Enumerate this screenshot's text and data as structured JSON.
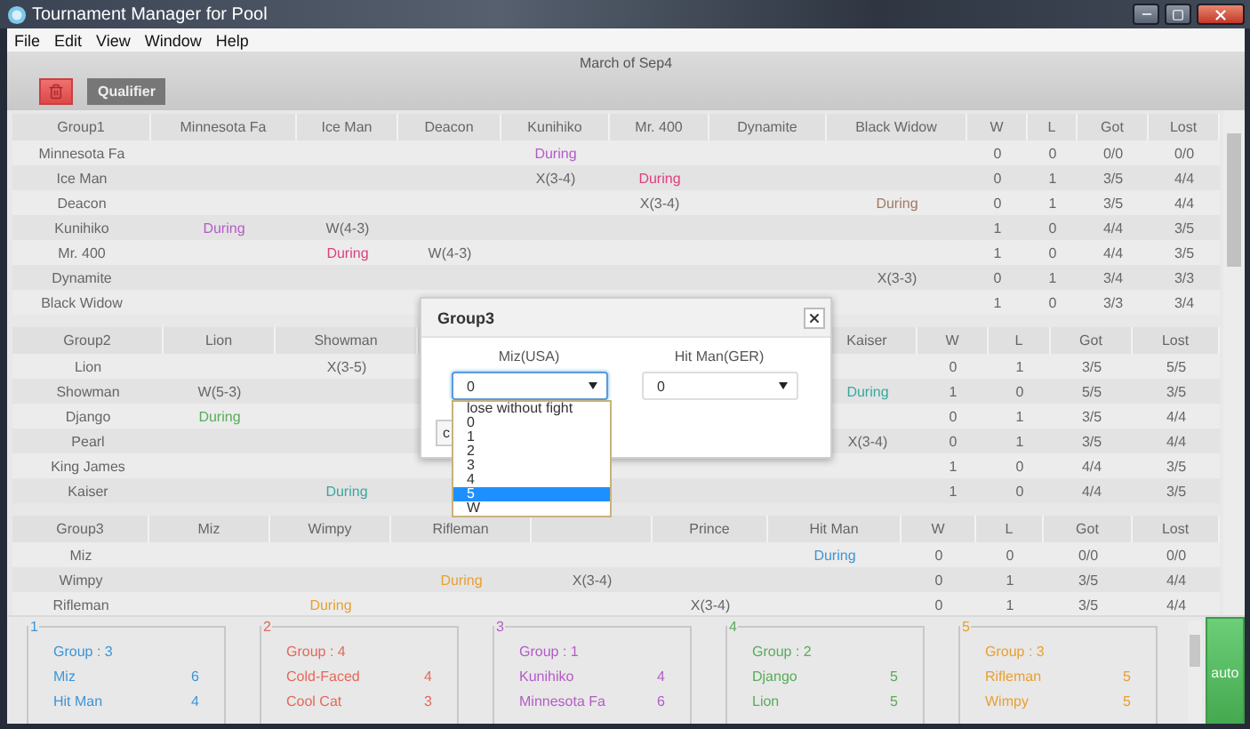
{
  "window": {
    "title": "Tournament Manager for Pool"
  },
  "menu": [
    "File",
    "Edit",
    "View",
    "Window",
    "Help"
  ],
  "header": {
    "title": "March of Sep4"
  },
  "toolbar": [
    {
      "kind": "delete"
    },
    {
      "kind": "text",
      "label": "Qualifier"
    }
  ],
  "groups": [
    {
      "columns": [
        {
          "kind": "label",
          "label": "Group1"
        },
        {
          "kind": "label",
          "label": "Minnesota Fa"
        },
        {
          "kind": "label",
          "label": "Ice Man"
        },
        {
          "kind": "label",
          "label": "Deacon"
        },
        {
          "kind": "label",
          "label": "Kunihiko"
        },
        {
          "kind": "label",
          "label": "Mr. 400"
        },
        {
          "kind": "label",
          "label": "Dynamite"
        },
        {
          "kind": "label",
          "label": "Black Widow"
        },
        {
          "kind": "label",
          "label": "W"
        },
        {
          "kind": "label",
          "label": "L"
        },
        {
          "kind": "label",
          "label": "Got"
        },
        {
          "kind": "label",
          "label": "Lost"
        }
      ],
      "rows": [
        {
          "name": "Minnesota Fa",
          "results": [
            {
              "kind": "empty"
            },
            {
              "kind": "empty"
            },
            {
              "kind": "empty"
            },
            {
              "kind": "status",
              "text": "During",
              "color": "#b25cc6"
            },
            {
              "kind": "empty"
            },
            {
              "kind": "empty"
            },
            {
              "kind": "empty"
            }
          ],
          "w": "0",
          "l": "0",
          "got": "0/0",
          "lost": "0/0"
        },
        {
          "name": "Ice Man",
          "results": [
            {
              "kind": "empty"
            },
            {
              "kind": "empty"
            },
            {
              "kind": "empty"
            },
            {
              "kind": "score",
              "text": "X(3-4)"
            },
            {
              "kind": "status",
              "text": "During",
              "color": "#dd3f7d"
            },
            {
              "kind": "empty"
            },
            {
              "kind": "empty"
            }
          ],
          "w": "0",
          "l": "1",
          "got": "3/5",
          "lost": "4/4"
        },
        {
          "name": "Deacon",
          "results": [
            {
              "kind": "empty"
            },
            {
              "kind": "empty"
            },
            {
              "kind": "empty"
            },
            {
              "kind": "empty"
            },
            {
              "kind": "score",
              "text": "X(3-4)"
            },
            {
              "kind": "empty"
            },
            {
              "kind": "status",
              "text": "During",
              "color": "#a07862"
            }
          ],
          "w": "0",
          "l": "1",
          "got": "3/5",
          "lost": "4/4"
        },
        {
          "name": "Kunihiko",
          "results": [
            {
              "kind": "status",
              "text": "During",
              "color": "#b25cc6"
            },
            {
              "kind": "score",
              "text": "W(4-3)"
            },
            {
              "kind": "empty"
            },
            {
              "kind": "empty"
            },
            {
              "kind": "empty"
            },
            {
              "kind": "empty"
            },
            {
              "kind": "empty"
            }
          ],
          "w": "1",
          "l": "0",
          "got": "4/4",
          "lost": "3/5"
        },
        {
          "name": "Mr. 400",
          "results": [
            {
              "kind": "empty"
            },
            {
              "kind": "status",
              "text": "During",
              "color": "#dd3f7d"
            },
            {
              "kind": "score",
              "text": "W(4-3)"
            },
            {
              "kind": "empty"
            },
            {
              "kind": "empty"
            },
            {
              "kind": "empty"
            },
            {
              "kind": "empty"
            }
          ],
          "w": "1",
          "l": "0",
          "got": "4/4",
          "lost": "3/5"
        },
        {
          "name": "Dynamite",
          "results": [
            {
              "kind": "empty"
            },
            {
              "kind": "empty"
            },
            {
              "kind": "empty"
            },
            {
              "kind": "empty"
            },
            {
              "kind": "empty"
            },
            {
              "kind": "empty"
            },
            {
              "kind": "score",
              "text": "X(3-3)"
            }
          ],
          "w": "0",
          "l": "1",
          "got": "3/4",
          "lost": "3/3"
        },
        {
          "name": "Black Widow",
          "results": [
            {
              "kind": "empty"
            },
            {
              "kind": "empty"
            },
            {
              "kind": "empty"
            },
            {
              "kind": "empty"
            },
            {
              "kind": "empty"
            },
            {
              "kind": "empty"
            },
            {
              "kind": "empty"
            }
          ],
          "w": "1",
          "l": "0",
          "got": "3/3",
          "lost": "3/4"
        }
      ]
    },
    {
      "columns": [
        {
          "kind": "label",
          "label": "Group2"
        },
        {
          "kind": "label",
          "label": "Lion"
        },
        {
          "kind": "label",
          "label": "Showman"
        },
        {
          "kind": "blank"
        },
        {
          "kind": "blank"
        },
        {
          "kind": "blank"
        },
        {
          "kind": "label",
          "label": "Kaiser"
        },
        {
          "kind": "label",
          "label": "W"
        },
        {
          "kind": "label",
          "label": "L"
        },
        {
          "kind": "label",
          "label": "Got"
        },
        {
          "kind": "label",
          "label": "Lost"
        }
      ],
      "rows": [
        {
          "name": "Lion",
          "results": [
            {
              "kind": "empty"
            },
            {
              "kind": "score",
              "text": "X(3-5)"
            },
            {
              "kind": "empty"
            },
            {
              "kind": "empty"
            },
            {
              "kind": "empty"
            },
            {
              "kind": "empty"
            }
          ],
          "w": "0",
          "l": "1",
          "got": "3/5",
          "lost": "5/5"
        },
        {
          "name": "Showman",
          "results": [
            {
              "kind": "score",
              "text": "W(5-3)"
            },
            {
              "kind": "empty"
            },
            {
              "kind": "empty"
            },
            {
              "kind": "empty"
            },
            {
              "kind": "empty"
            },
            {
              "kind": "status",
              "text": "During",
              "color": "#3aa79e"
            }
          ],
          "w": "1",
          "l": "0",
          "got": "5/5",
          "lost": "3/5"
        },
        {
          "name": "Django",
          "results": [
            {
              "kind": "status",
              "text": "During",
              "color": "#5aab5a"
            },
            {
              "kind": "empty"
            },
            {
              "kind": "empty"
            },
            {
              "kind": "empty"
            },
            {
              "kind": "empty"
            },
            {
              "kind": "empty"
            }
          ],
          "w": "0",
          "l": "1",
          "got": "3/5",
          "lost": "4/4"
        },
        {
          "name": "Pearl",
          "results": [
            {
              "kind": "empty"
            },
            {
              "kind": "empty"
            },
            {
              "kind": "empty"
            },
            {
              "kind": "empty"
            },
            {
              "kind": "empty"
            },
            {
              "kind": "score",
              "text": "X(3-4)"
            }
          ],
          "w": "0",
          "l": "1",
          "got": "3/5",
          "lost": "4/4"
        },
        {
          "name": "King James",
          "results": [
            {
              "kind": "empty"
            },
            {
              "kind": "empty"
            },
            {
              "kind": "empty"
            },
            {
              "kind": "empty"
            },
            {
              "kind": "empty"
            },
            {
              "kind": "empty"
            }
          ],
          "w": "1",
          "l": "0",
          "got": "4/4",
          "lost": "3/5"
        },
        {
          "name": "Kaiser",
          "results": [
            {
              "kind": "empty"
            },
            {
              "kind": "status",
              "text": "During",
              "color": "#3aa79e"
            },
            {
              "kind": "empty"
            },
            {
              "kind": "empty"
            },
            {
              "kind": "empty"
            },
            {
              "kind": "empty"
            }
          ],
          "w": "1",
          "l": "0",
          "got": "4/4",
          "lost": "3/5"
        }
      ]
    },
    {
      "columns": [
        {
          "kind": "label",
          "label": "Group3"
        },
        {
          "kind": "label",
          "label": "Miz"
        },
        {
          "kind": "label",
          "label": "Wimpy"
        },
        {
          "kind": "label",
          "label": "Rifleman"
        },
        {
          "kind": "blank"
        },
        {
          "kind": "label",
          "label": "Prince"
        },
        {
          "kind": "label",
          "label": "Hit Man"
        },
        {
          "kind": "label",
          "label": "W"
        },
        {
          "kind": "label",
          "label": "L"
        },
        {
          "kind": "label",
          "label": "Got"
        },
        {
          "kind": "label",
          "label": "Lost"
        }
      ],
      "rows": [
        {
          "name": "Miz",
          "results": [
            {
              "kind": "empty"
            },
            {
              "kind": "empty"
            },
            {
              "kind": "empty"
            },
            {
              "kind": "empty"
            },
            {
              "kind": "empty"
            },
            {
              "kind": "status",
              "text": "During",
              "color": "#3b95d8"
            }
          ],
          "w": "0",
          "l": "0",
          "got": "0/0",
          "lost": "0/0"
        },
        {
          "name": "Wimpy",
          "results": [
            {
              "kind": "empty"
            },
            {
              "kind": "empty"
            },
            {
              "kind": "status",
              "text": "During",
              "color": "#e8a030"
            },
            {
              "kind": "score",
              "text": "X(3-4)"
            },
            {
              "kind": "empty"
            },
            {
              "kind": "empty"
            }
          ],
          "w": "0",
          "l": "1",
          "got": "3/5",
          "lost": "4/4"
        },
        {
          "name": "Rifleman",
          "results": [
            {
              "kind": "empty"
            },
            {
              "kind": "status",
              "text": "During",
              "color": "#e8a030"
            },
            {
              "kind": "empty"
            },
            {
              "kind": "empty"
            },
            {
              "kind": "score",
              "text": "X(3-4)"
            },
            {
              "kind": "empty"
            }
          ],
          "w": "0",
          "l": "1",
          "got": "3/5",
          "lost": "4/4"
        }
      ]
    }
  ],
  "dialog": {
    "title": "Group3",
    "players": [
      {
        "label": "Miz(USA)",
        "value": "0",
        "open": true
      },
      {
        "label": "Hit Man(GER)",
        "value": "0",
        "open": false
      }
    ],
    "button": "c",
    "options": [
      {
        "label": "lose without fight",
        "selected": false
      },
      {
        "label": "0",
        "selected": false
      },
      {
        "label": "1",
        "selected": false
      },
      {
        "label": "2",
        "selected": false
      },
      {
        "label": "3",
        "selected": false
      },
      {
        "label": "4",
        "selected": false
      },
      {
        "label": "5",
        "selected": true
      },
      {
        "label": "W",
        "selected": false
      }
    ]
  },
  "rankings": [
    {
      "number": "1",
      "color": "#3b95d8",
      "group": "Group : 3",
      "players": [
        {
          "name": "Miz",
          "score": "6"
        },
        {
          "name": "Hit Man",
          "score": "4"
        }
      ]
    },
    {
      "number": "2",
      "color": "#e4685a",
      "group": "Group : 4",
      "players": [
        {
          "name": "Cold-Faced",
          "score": "4"
        },
        {
          "name": "Cool Cat",
          "score": "3"
        }
      ]
    },
    {
      "number": "3",
      "color": "#b25cc6",
      "group": "Group : 1",
      "players": [
        {
          "name": "Kunihiko",
          "score": "4"
        },
        {
          "name": "Minnesota Fa",
          "score": "6"
        }
      ]
    },
    {
      "number": "4",
      "color": "#5aab5a",
      "group": "Group : 2",
      "players": [
        {
          "name": "Django",
          "score": "5"
        },
        {
          "name": "Lion",
          "score": "5"
        }
      ]
    },
    {
      "number": "5",
      "color": "#e8a030",
      "group": "Group : 3",
      "players": [
        {
          "name": "Rifleman",
          "score": "5"
        },
        {
          "name": "Wimpy",
          "score": "5"
        }
      ]
    }
  ],
  "auto_button": "auto"
}
